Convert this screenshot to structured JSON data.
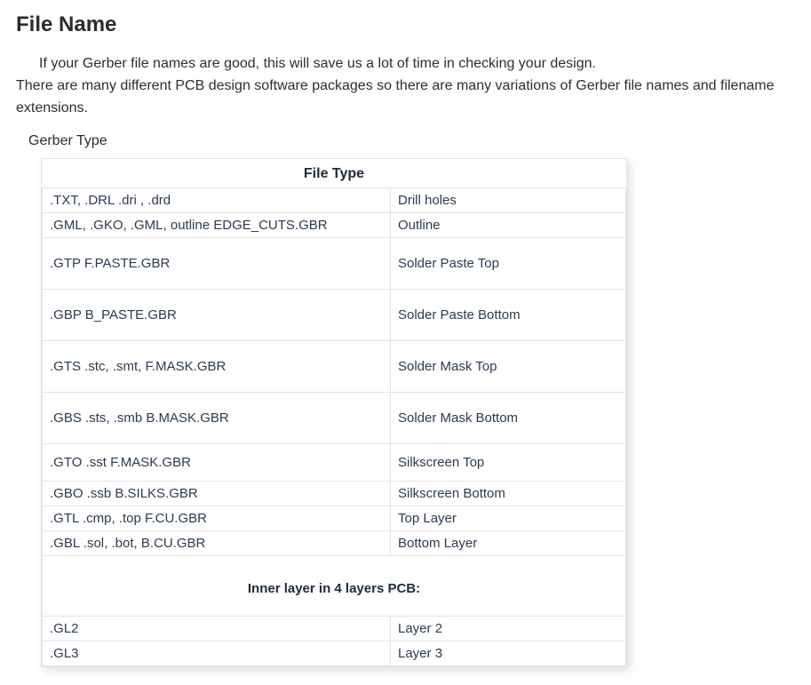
{
  "title": "File Name",
  "intro1": "If your Gerber file names are good, this will save us a lot of time in checking your design.",
  "intro2": "There are many different PCB design software packages so there are many variations of Gerber file names and filename extensions.",
  "subhead": "Gerber Type",
  "table_header": "File Type",
  "rows": [
    {
      "ext": ".TXT, .DRL  .dri ,  .drd",
      "desc": "Drill holes"
    },
    {
      "ext": ".GML,  .GKO,  .GML, outline EDGE_CUTS.GBR",
      "desc": "Outline"
    },
    {
      "ext": ".GTP   F.PASTE.GBR",
      "desc": "Solder Paste Top"
    },
    {
      "ext": ".GBP B_PASTE.GBR",
      "desc": "Solder Paste Bottom"
    },
    {
      "ext": ".GTS   .stc,  .smt, F.MASK.GBR",
      "desc": "Solder Mask Top"
    },
    {
      "ext": ".GBS  .sts,  .smb B.MASK.GBR",
      "desc": "Solder Mask Bottom"
    },
    {
      "ext": ".GTO .sst F.MASK.GBR",
      "desc": "Silkscreen Top"
    },
    {
      "ext": ".GBO .ssb B.SILKS.GBR",
      "desc": "Silkscreen Bottom"
    },
    {
      "ext": ".GTL   .cmp,    .top F.CU.GBR",
      "desc": "Top Layer"
    },
    {
      "ext": ".GBL    .sol,     .bot,  B.CU.GBR",
      "desc": "Bottom Layer"
    }
  ],
  "inner_title": "Inner layer in 4 layers PCB:",
  "inner_rows": [
    {
      "ext": ".GL2",
      "desc": "Layer 2"
    },
    {
      "ext": ".GL3",
      "desc": "Layer 3"
    }
  ]
}
